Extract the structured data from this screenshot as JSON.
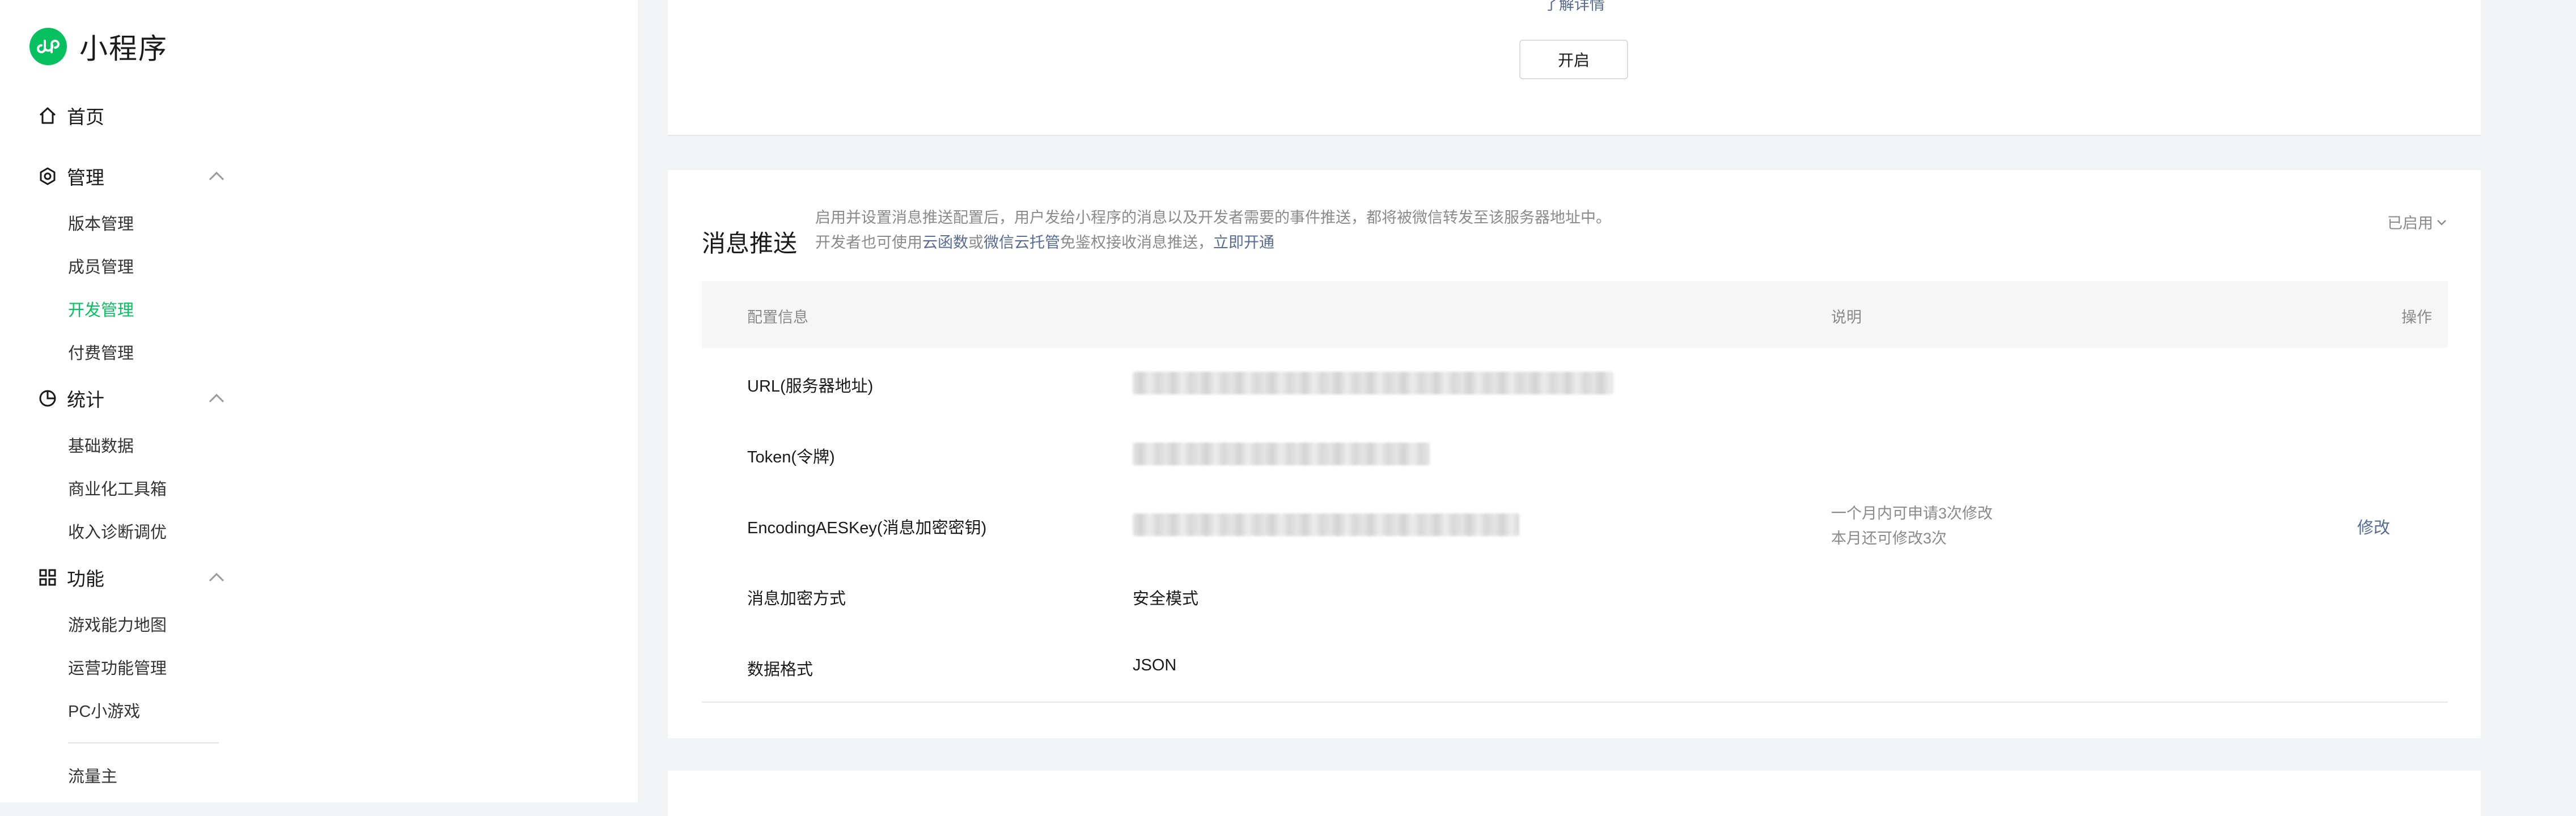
{
  "sidebar": {
    "brand": "小程序",
    "home": "首页",
    "sections": [
      {
        "label": "管理",
        "items": [
          "版本管理",
          "成员管理",
          "开发管理",
          "付费管理"
        ]
      },
      {
        "label": "统计",
        "items": [
          "基础数据",
          "商业化工具箱",
          "收入诊断调优"
        ]
      },
      {
        "label": "功能",
        "items": [
          "游戏能力地图",
          "运营功能管理",
          "PC小游戏"
        ]
      }
    ],
    "active_item": "开发管理",
    "after_divider": "流量主"
  },
  "top_card": {
    "detail_link": "了解详情",
    "open_button": "开启"
  },
  "push_card": {
    "title": "消息推送",
    "desc_line1": "启用并设置消息推送配置后，用户发给小程序的消息以及开发者需要的事件推送，都将被微信转发至该服务器地址中。",
    "desc_line2_prefix": "开发者也可使用",
    "link_cloud_function": "云函数",
    "desc_or": "或",
    "link_cloud_hosting": "微信云托管",
    "desc_line2_suffix": "免鉴权接收消息推送，",
    "link_open_now": "立即开通",
    "status": "已启用",
    "table": {
      "headers": {
        "config": "配置信息",
        "note": "说明",
        "action": "操作"
      },
      "rows": [
        {
          "label": "URL(服务器地址)"
        },
        {
          "label": "Token(令牌)"
        },
        {
          "label": "EncodingAESKey(消息加密密钥)",
          "note_line1": "一个月内可申请3次修改",
          "note_line2": "本月还可修改3次",
          "action": "修改"
        },
        {
          "label": "消息加密方式",
          "value": "安全模式"
        },
        {
          "label": "数据格式",
          "value": "JSON"
        }
      ]
    }
  },
  "colors": {
    "brand_green": "#07c160",
    "link_blue": "#576b95",
    "muted_gray": "#8a8a8a"
  }
}
